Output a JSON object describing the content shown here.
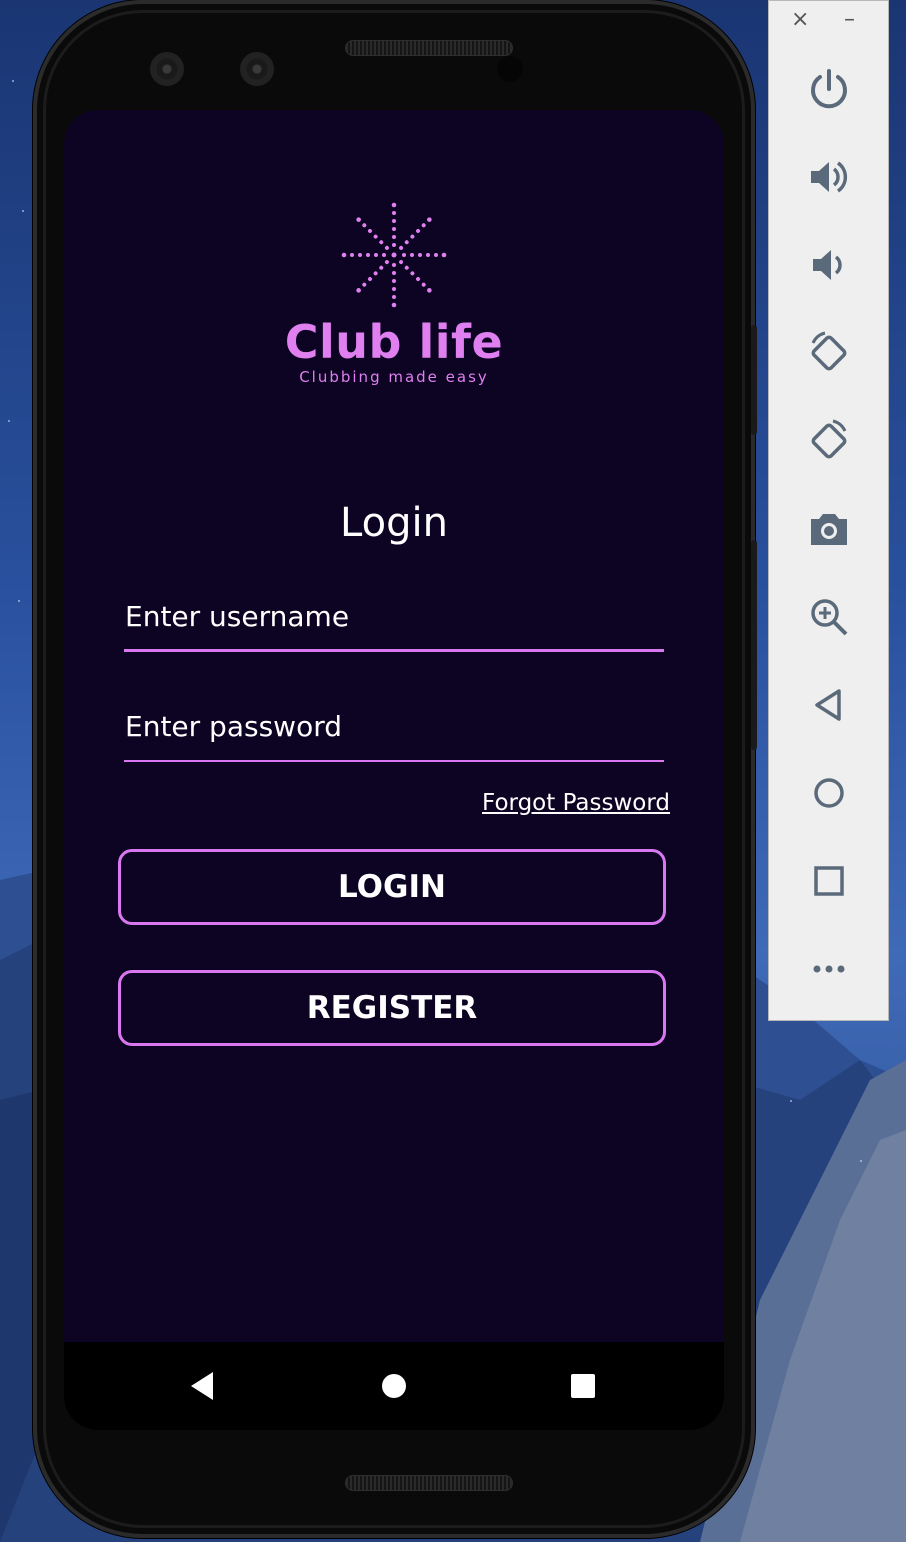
{
  "app": {
    "brand_name": "Club life",
    "tagline": "Clubbing made easy",
    "accent_color": "#d977f0",
    "background_color": "#0d0322"
  },
  "login": {
    "title": "Login",
    "username_placeholder": "Enter username",
    "password_placeholder": "Enter password",
    "forgot_password": "Forgot Password",
    "login_button": "LOGIN",
    "register_button": "REGISTER"
  },
  "android_nav": [
    "back-icon",
    "home-icon",
    "recents-icon"
  ],
  "emulator_toolbar": {
    "window_controls": {
      "close": "×",
      "minimize": "–"
    },
    "buttons": [
      "power-icon",
      "volume-up-icon",
      "volume-down-icon",
      "rotate-left-icon",
      "rotate-right-icon",
      "camera-icon",
      "zoom-icon",
      "back-icon",
      "home-icon",
      "overview-icon",
      "more-icon"
    ]
  }
}
